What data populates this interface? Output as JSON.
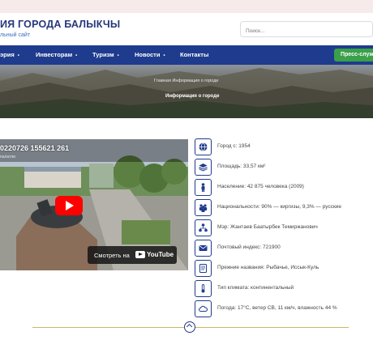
{
  "header": {
    "site_title": "ИЯ ГОРОДА БАЛЫКЧЫ",
    "site_subtitle": "льный сайт",
    "search_placeholder": "Поиск..."
  },
  "nav": {
    "items": [
      {
        "label": "эрия",
        "has_submenu": true
      },
      {
        "label": "Инвесторам",
        "has_submenu": true
      },
      {
        "label": "Туризм",
        "has_submenu": true
      },
      {
        "label": "Новости",
        "has_submenu": true
      },
      {
        "label": "Контакты",
        "has_submenu": false
      }
    ],
    "press_button": "Пресс-служб",
    "submenu_marker": "•"
  },
  "hero": {
    "breadcrumb": "Главная   Информация о городе",
    "title": "Информация о городе"
  },
  "video": {
    "title": "0220726 155621 261",
    "subtitle": "палатли",
    "watch_on_label": "Смотреть на",
    "youtube_word": "YouTube"
  },
  "facts": [
    {
      "icon": "globe-icon",
      "text": "Город с: 1954"
    },
    {
      "icon": "layers-icon",
      "text": "Площадь: 33,57 км²"
    },
    {
      "icon": "person-icon",
      "text": "Население: 42 875 человека (2009)"
    },
    {
      "icon": "group-icon",
      "text": "Национальности: 90% — киргизы, 9,3% — русские"
    },
    {
      "icon": "org-chart-icon",
      "text": "Мэр: Жантаев Баатырбек Темиржанович"
    },
    {
      "icon": "mail-icon",
      "text": "Почтовый индекс: 721900"
    },
    {
      "icon": "document-icon",
      "text": "Прежние названия: Рыбачье, Иссык-Куль"
    },
    {
      "icon": "thermometer-icon",
      "text": "Тип климата: континентальный"
    },
    {
      "icon": "cloud-icon",
      "text": "Погода: 17°C, ветер СВ, 11 км/ч, влажность 44 %"
    }
  ],
  "colors": {
    "brand_navy": "#1f3b8e",
    "press_green": "#3aa04a",
    "accent_gold": "#c9b86a"
  }
}
